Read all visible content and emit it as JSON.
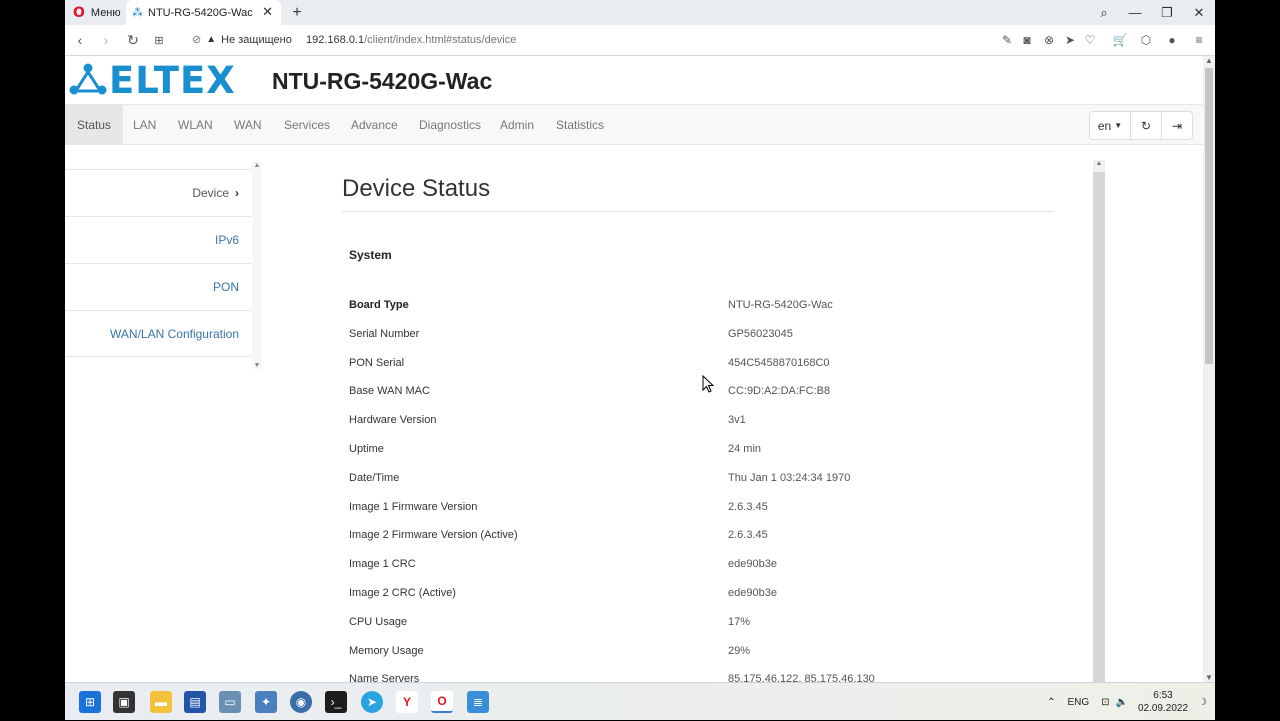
{
  "browser": {
    "menu_tab_label": "Меню",
    "active_tab_title": "NTU-RG-5420G-Wac",
    "security_label": "Не защищено",
    "url_host": "192.168.0.1",
    "url_path": "/client/index.html#status/device"
  },
  "header": {
    "logo_text": "ELTEX",
    "model_title": "NTU-RG-5420G-Wac"
  },
  "navbar": {
    "items": [
      {
        "label": "Status",
        "active": true
      },
      {
        "label": "LAN"
      },
      {
        "label": "WLAN"
      },
      {
        "label": "WAN"
      },
      {
        "label": "Services"
      },
      {
        "label": "Advance"
      },
      {
        "label": "Diagnostics"
      },
      {
        "label": "Admin"
      },
      {
        "label": "Statistics"
      }
    ],
    "language": "en"
  },
  "sidebar": {
    "items": [
      {
        "label": "Device",
        "active": true
      },
      {
        "label": "IPv6"
      },
      {
        "label": "PON"
      },
      {
        "label": "WAN/LAN Configuration"
      }
    ]
  },
  "content": {
    "title": "Device Status",
    "section": "System",
    "rows": [
      {
        "key": "Board Type",
        "value": "NTU-RG-5420G-Wac"
      },
      {
        "key": "Serial Number",
        "value": "GP56023045"
      },
      {
        "key": "PON Serial",
        "value": "454C5458870168C0"
      },
      {
        "key": "Base WAN MAC",
        "value": "CC:9D:A2:DA:FC:B8"
      },
      {
        "key": "Hardware Version",
        "value": "3v1"
      },
      {
        "key": "Uptime",
        "value": "24 min"
      },
      {
        "key": "Date/Time",
        "value": "Thu Jan  1 03:24:34 1970"
      },
      {
        "key": "Image 1 Firmware Version",
        "value": "2.6.3.45"
      },
      {
        "key": "Image 2 Firmware Version (Active)",
        "value": "2.6.3.45"
      },
      {
        "key": "Image 1 CRC",
        "value": "ede90b3e"
      },
      {
        "key": "Image 2 CRC (Active)",
        "value": "ede90b3e"
      },
      {
        "key": "CPU Usage",
        "value": "17%"
      },
      {
        "key": "Memory Usage",
        "value": "29%"
      },
      {
        "key": "Name Servers",
        "value": "85.175.46.122, 85.175.46.130"
      }
    ]
  },
  "taskbar": {
    "language": "ENG",
    "time": "6:53",
    "date": "02.09.2022"
  }
}
